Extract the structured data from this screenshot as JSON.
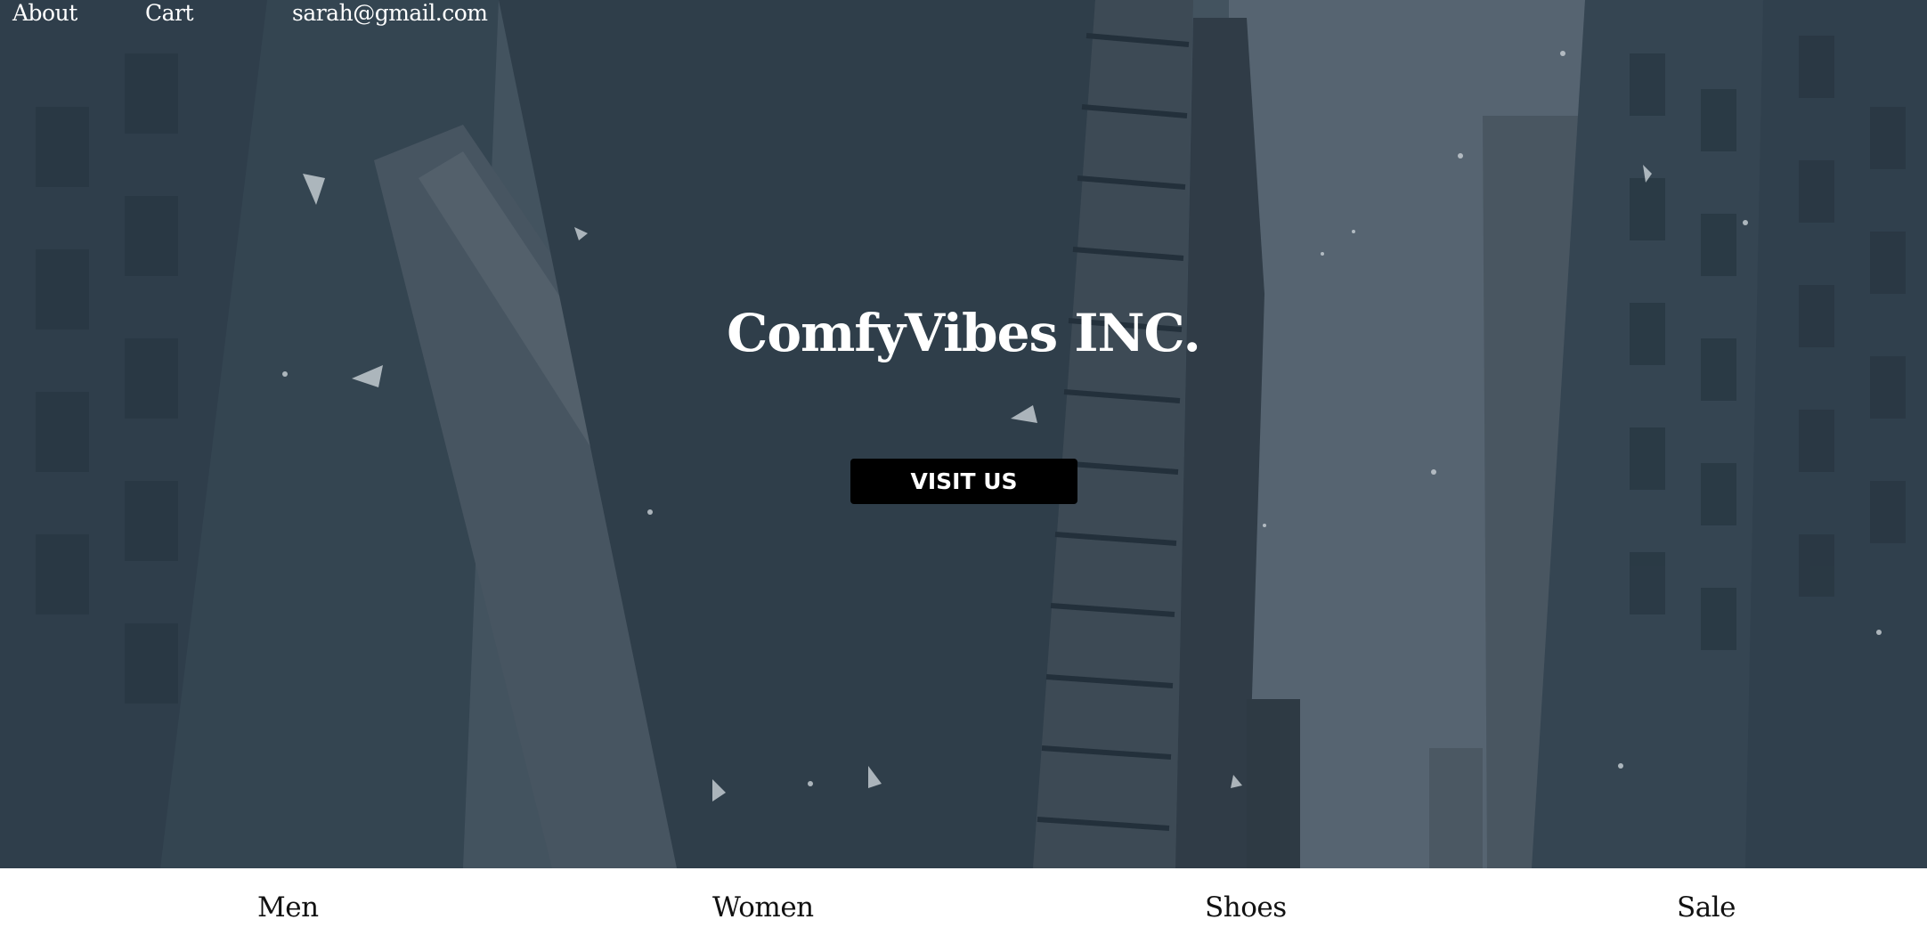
{
  "nav": {
    "about": "About",
    "cart": "Cart",
    "email": "sarah@gmail.com"
  },
  "hero": {
    "title": "ComfyVibes INC.",
    "button_label": "VISIT US"
  },
  "categories": {
    "men": "Men",
    "women": "Women",
    "shoes": "Shoes",
    "sale": "Sale"
  }
}
